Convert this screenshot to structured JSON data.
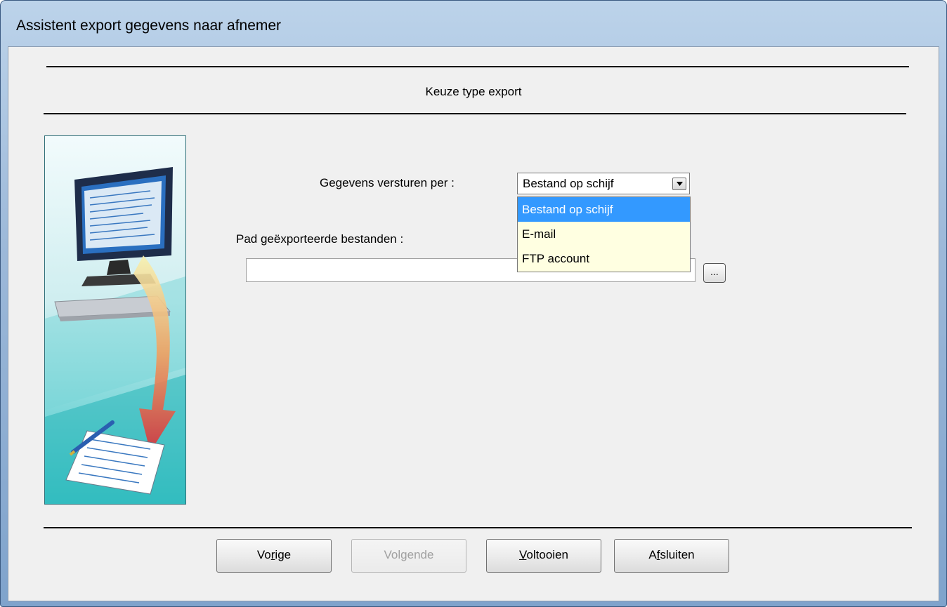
{
  "window": {
    "title": "Assistent export gegevens naar afnemer"
  },
  "wizard": {
    "heading": "Keuze type export"
  },
  "form": {
    "send_label": "Gegevens versturen per :",
    "send_value": "Bestand op schijf",
    "send_options": [
      "Bestand op schijf",
      "E-mail",
      "FTP account"
    ],
    "send_selected_index": 0,
    "path_label": "Pad geëxporteerde bestanden :",
    "path_value": "",
    "browse_label": "..."
  },
  "buttons": {
    "prev": {
      "before": "Vo",
      "mnemonic": "r",
      "after": "ige"
    },
    "next": {
      "before": "Vol",
      "mnemonic": "g",
      "after": "ende"
    },
    "finish": {
      "before": "",
      "mnemonic": "V",
      "after": "oltooien"
    },
    "close": {
      "before": "A",
      "mnemonic": "f",
      "after": "sluiten"
    }
  },
  "colors": {
    "selection": "#3399ff",
    "dropdown_bg": "#ffffe1",
    "client_bg": "#f0f0f0"
  }
}
